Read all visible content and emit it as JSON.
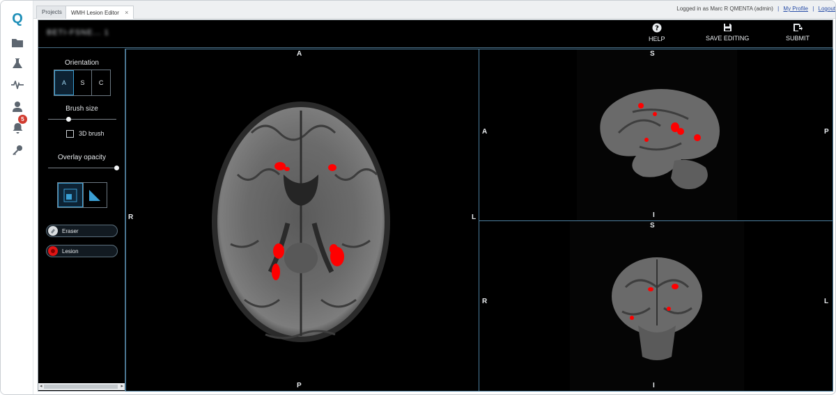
{
  "tabs": [
    {
      "label": "Projects",
      "active": false
    },
    {
      "label": "WMH Lesion Editor",
      "active": true
    }
  ],
  "tab_close": "×",
  "top_right": {
    "logged_in_prefix": "Logged in as",
    "user": "Marc R QMENTA (admin)",
    "my_profile": "My Profile",
    "logout": "Logout",
    "separator": "|"
  },
  "rail": {
    "logo": "Q",
    "items": [
      "folder-icon",
      "flask-icon",
      "activity-icon",
      "user-icon",
      "bell-icon",
      "key-icon"
    ],
    "notification_count": "5"
  },
  "header": {
    "subject_title": "BETI-FSNE... 1",
    "help_label": "HELP",
    "save_label": "SAVE EDITING",
    "submit_label": "SUBMIT"
  },
  "panel": {
    "orientation_title": "Orientation",
    "orientation_options": [
      "A",
      "S",
      "C"
    ],
    "orientation_selected": "A",
    "brush_size_title": "Brush size",
    "brush_size_value": 0.3,
    "brush3d_label": "3D brush",
    "brush3d_checked": false,
    "overlay_title": "Overlay opacity",
    "overlay_value": 1.0,
    "labels": [
      {
        "name": "Eraser",
        "color": "#d9dde0"
      },
      {
        "name": "Lesion",
        "color": "#e01515"
      }
    ]
  },
  "views": {
    "axial": {
      "top": "A",
      "bottom": "P",
      "left": "R",
      "right": "L"
    },
    "sagittal": {
      "top": "S",
      "bottom": "I",
      "left": "A",
      "right": "P"
    },
    "coronal": {
      "top": "S",
      "bottom": "I",
      "left": "R",
      "right": "L"
    }
  },
  "colors": {
    "lesion": "#ff0000",
    "accent": "#3a9fd4",
    "viewport_border": "#4d7e9e",
    "notification_badge": "#d13b2f"
  }
}
